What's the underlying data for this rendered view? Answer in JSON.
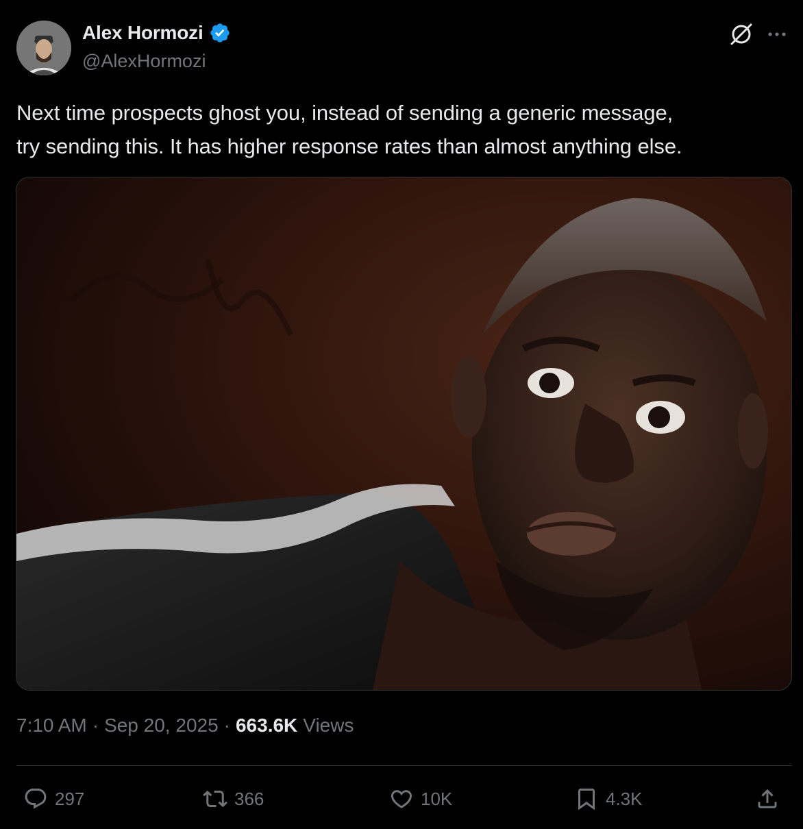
{
  "author": {
    "name": "Alex Hormozi",
    "handle": "@AlexHormozi",
    "verified_icon": "verified-badge-icon",
    "verified_color": "#1d9bf0"
  },
  "header_icons": {
    "grok": "grok-icon",
    "more": "more-icon"
  },
  "tweet": {
    "line1": "Next time prospects ghost you, instead of sending a generic message,",
    "line2": "try sending this. It has higher response rates than almost anything else."
  },
  "media": {
    "kind": "photo"
  },
  "meta": {
    "time": "7:10 AM",
    "separator": "·",
    "date": "Sep 20, 2025",
    "views_count": "663.6K",
    "views_label": "Views"
  },
  "actions": {
    "replies": "297",
    "reposts": "366",
    "likes": "10K",
    "bookmarks": "4.3K"
  },
  "colors": {
    "background": "#000000",
    "text": "#e7e9ea",
    "muted": "#71767b",
    "divider": "#2f3336"
  }
}
